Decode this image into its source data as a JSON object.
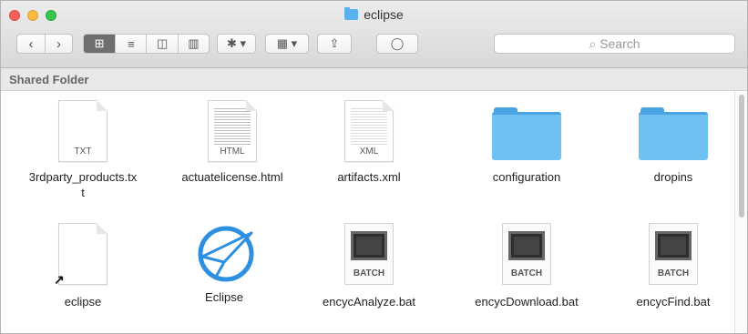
{
  "window": {
    "title": "eclipse",
    "toolbar": {
      "back": "‹",
      "forward": "›",
      "views": [
        "⊞",
        "≡",
        "◫",
        "▥"
      ],
      "action": "✱ ▾",
      "arrange": "▦ ▾",
      "share": "⇪",
      "tag": "◯",
      "search_placeholder": "Search"
    },
    "section_header": "Shared Folder"
  },
  "files": [
    {
      "name": "3rdparty_products.txt",
      "kind": "text",
      "badge": "TXT"
    },
    {
      "name": "actuatelicense.html",
      "kind": "text",
      "badge": "HTML"
    },
    {
      "name": "artifacts.xml",
      "kind": "text",
      "badge": "XML"
    },
    {
      "name": "configuration",
      "kind": "folder"
    },
    {
      "name": "dropins",
      "kind": "folder"
    },
    {
      "name": "eclipse",
      "kind": "alias"
    },
    {
      "name": "Eclipse",
      "kind": "app"
    },
    {
      "name": "encycAnalyze.bat",
      "kind": "batch",
      "badge": "BATCH"
    },
    {
      "name": "encycDownload.bat",
      "kind": "batch",
      "badge": "BATCH"
    },
    {
      "name": "encycFind.bat",
      "kind": "batch",
      "badge": "BATCH"
    }
  ],
  "colors": {
    "folder": "#6fc1f3",
    "selected_view": "#6e6e6e",
    "close": "#fc605b",
    "minimize": "#fdbc40",
    "maximize": "#34c84a"
  }
}
